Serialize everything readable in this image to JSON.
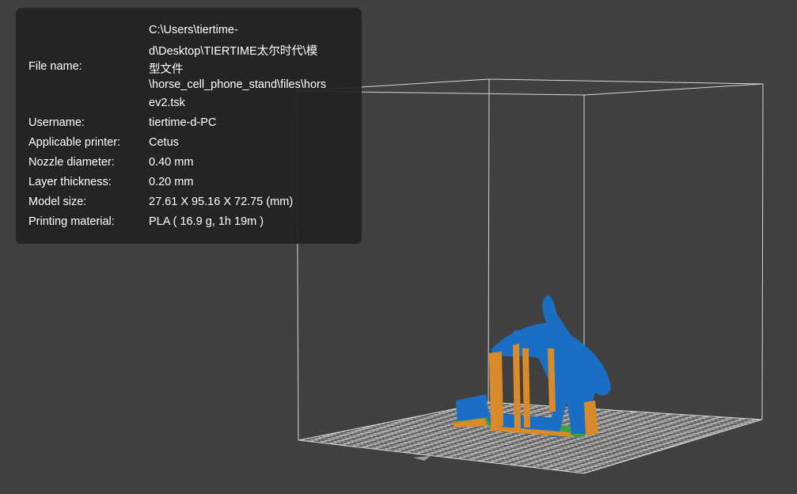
{
  "info_panel": {
    "file_name": {
      "label": "File name:",
      "lines": [
        "C:\\Users\\tiertime-",
        "d\\Desktop\\TIERTIME太尔时代\\模",
        "型文件",
        "\\horse_cell_phone_stand\\files\\hors",
        "ev2.tsk"
      ]
    },
    "username": {
      "label": "Username:",
      "value": "tiertime-d-PC"
    },
    "printer": {
      "label": "Applicable printer:",
      "value": "Cetus"
    },
    "nozzle": {
      "label": "Nozzle diameter:",
      "value": "0.40 mm"
    },
    "layer": {
      "label": "Layer thickness:",
      "value": "0.20 mm"
    },
    "model_size": {
      "label": "Model size:",
      "value": "27.61 X 95.16 X 72.75 (mm)"
    },
    "material": {
      "label": "Printing material:",
      "value": "PLA ( 16.9 g, 1h 19m )"
    }
  },
  "colors": {
    "background": "#404040",
    "panel": "#222222",
    "model": "#1a6fc4",
    "support": "#d98a2b",
    "raft": "#3aa53a",
    "bed_light": "#b5b5b5",
    "bed_dark": "#5a5a5a"
  }
}
